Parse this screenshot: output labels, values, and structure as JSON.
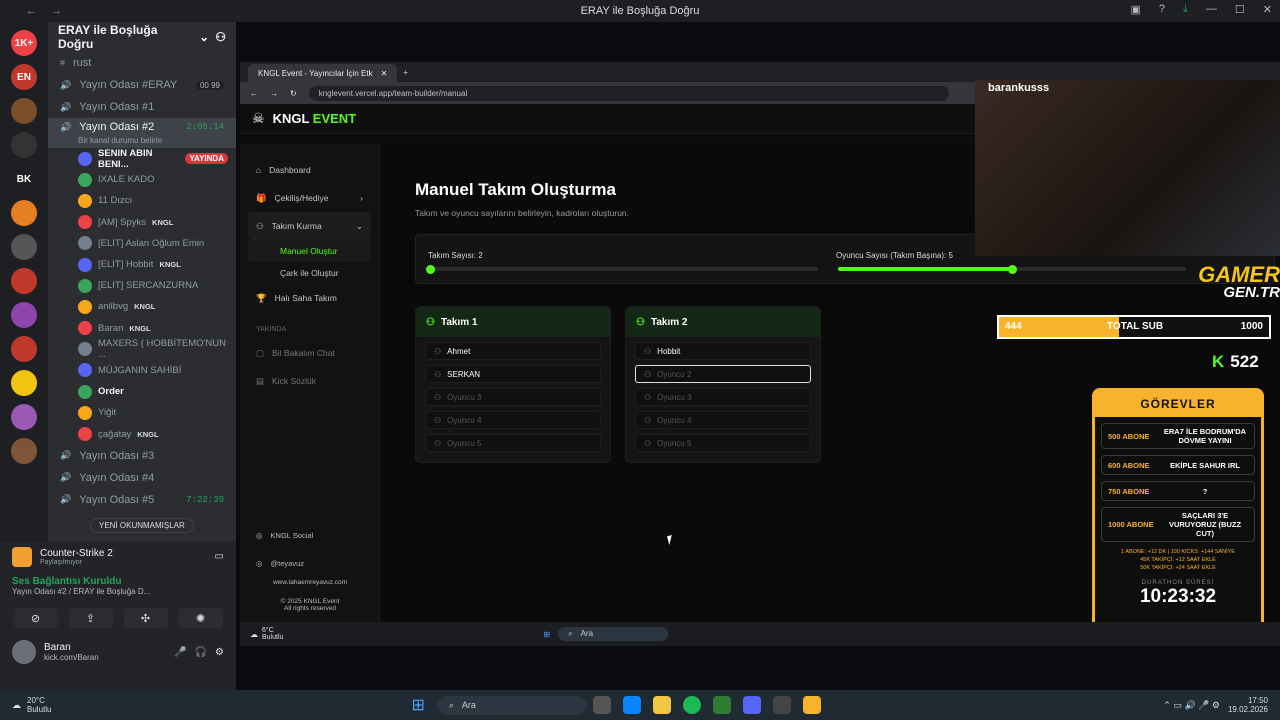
{
  "window": {
    "title": "ERAY ile Boşluğa Doğru"
  },
  "discord": {
    "server_name": "ERAY ile Boşluğa Doğru",
    "servers": [
      {
        "label": "1K+",
        "color": "#ed4245"
      },
      {
        "label": "EN",
        "color": "#c0392b"
      },
      {
        "label": "",
        "color": "#7b4f2c"
      },
      {
        "label": "",
        "color": "#333"
      },
      {
        "label": "BK",
        "color": "#1e1f22"
      },
      {
        "label": "",
        "color": "#e67e22"
      },
      {
        "label": "",
        "color": "#555"
      },
      {
        "label": "",
        "color": "#c0392b"
      },
      {
        "label": "",
        "color": "#8e44ad"
      },
      {
        "label": "",
        "color": "#c0392b"
      },
      {
        "label": "",
        "color": "#f1c40f"
      },
      {
        "label": "",
        "color": "#9b59b6"
      },
      {
        "label": "",
        "color": "#7f5539"
      }
    ],
    "channels": [
      {
        "name": "rust",
        "type": "text"
      },
      {
        "name": "Yayın Odası #ERAY",
        "count": "00 99"
      },
      {
        "name": "Yayın Odası #1"
      },
      {
        "name": "Yayın Odası #2",
        "time": "2:05:14",
        "active": true,
        "sub": "Bir kanal durumu belirle"
      }
    ],
    "users": [
      {
        "name": "SENIN ABIN BENI...",
        "bold": true,
        "live": "YAYINDA"
      },
      {
        "name": "IXALE KADO"
      },
      {
        "name": "11 Dızcı"
      },
      {
        "name": "[AM] Spyks",
        "tag": "KNGL"
      },
      {
        "name": "[ELIT] Aslan Oğlum Emin"
      },
      {
        "name": "[ELIT] Hobbit",
        "tag": "KNGL"
      },
      {
        "name": "[ELIT] SERCANZURNA"
      },
      {
        "name": "anilbvg",
        "tag": "KNGL"
      },
      {
        "name": "Baran",
        "tag": "KNGL"
      },
      {
        "name": "MAXERS ( HOBBİTEMO'NUN ..."
      },
      {
        "name": "MÜJGANIN SAHİBİ"
      },
      {
        "name": "Order",
        "bold": true
      },
      {
        "name": "Yiğit"
      },
      {
        "name": "çağatay",
        "tag": "KNGL"
      }
    ],
    "channels_after": [
      {
        "name": "Yayın Odası #3"
      },
      {
        "name": "Yayın Odası #4"
      },
      {
        "name": "Yayın Odası #5",
        "time": "7:22:39"
      }
    ],
    "new_unread": "YENİ OKUNMAMIŞLAR",
    "live_badge": "YAYINDA",
    "game": {
      "title": "Counter-Strike 2",
      "sub": "Paylaşılmıyor"
    },
    "voice": {
      "title": "Ses Bağlantısı Kuruldu",
      "sub": "Yayın Odası #2 / ERAY ile Boşluğa D..."
    },
    "me": {
      "name": "Baran",
      "status": "kick.com/Baran"
    },
    "weather": {
      "temp": "20°C",
      "desc": "Bulutlu"
    }
  },
  "browser": {
    "tab": "KNGL Event - Yayıncılar İçin Etk",
    "url": "knglevent.vercel.app/team-builder/manual",
    "logo_a": "KNGL",
    "logo_b": "EVENT",
    "nav": {
      "dashboard": "Dashboard",
      "giveaway": "Çekiliş/Hediye",
      "team": "Takım Kurma",
      "manual": "Manuel Oluştur",
      "wheel": "Çark ile Oluştur",
      "pitch": "Halı Saha Takım",
      "soon": "YAKINDA",
      "chat": "Bil Bakalım Chat",
      "dict": "Kick Sözlük"
    },
    "foot": {
      "social": "KNGL Social",
      "insta": "@teyavuz",
      "site": "www.tahaemreyavuz.com",
      "copy1": "© 2025 KNGL Event",
      "copy2": "All rights reserved"
    },
    "page": {
      "title": "Manuel Takım Oluşturma",
      "subtitle": "Takım ve oyuncu sayılarını belirleyin, kadroları oluşturun.",
      "team_count_label": "Takım Sayısı: 2",
      "team_count_fill": 0.0,
      "player_count_label": "Oyuncu Sayısı (Takım Başına): 5",
      "player_count_fill": 0.5,
      "teams": [
        {
          "name": "Takım 1",
          "slots": [
            {
              "v": "Ahmet"
            },
            {
              "v": "SERKAN"
            },
            {
              "p": "Oyuncu 3"
            },
            {
              "p": "Oyuncu 4"
            },
            {
              "p": "Oyuncu 5"
            }
          ]
        },
        {
          "name": "Takım 2",
          "slots": [
            {
              "v": "Hobbit"
            },
            {
              "p": "Oyuncu 2",
              "focus": true
            },
            {
              "p": "Oyuncu 3"
            },
            {
              "p": "Oyuncu 4"
            },
            {
              "p": "Oyuncu 5"
            }
          ]
        }
      ]
    }
  },
  "overlay": {
    "cam_name": "barankusss",
    "brand_a": "GAMER",
    "brand_b": "GEN.TR",
    "sub_current": "444",
    "sub_label": "TOTAL SUB",
    "sub_goal": "1000",
    "sub_fill": 0.444,
    "kick_count": "522",
    "quests_title": "GÖREVLER",
    "quests": [
      {
        "a": "500 ABONE",
        "b": "ERA7 İLE BODRUM'DA DÖVME YAYINI"
      },
      {
        "a": "600 ABONE",
        "b": "EKİPLE SAHUR IRL"
      },
      {
        "a": "750 ABONE",
        "b": "?"
      },
      {
        "a": "1000 ABONE",
        "b": "SAÇLARI 3'E VURUYORUZ (BUZZ CUT)"
      }
    ],
    "note1": "1 ABONE: +12 DK | 100 KICKS: +144 SANİYE",
    "note2": "45K TAKİPÇİ: +12 SAAT EKLE",
    "note3": "50K TAKİPÇİ: +24 SAAT EKLE",
    "timer_label": "DURATHON SÜRESİ",
    "timer": "10:23:32"
  },
  "inner_taskbar": {
    "temp": "6°C",
    "desc": "Bulutlu",
    "search": "Ara"
  },
  "taskbar": {
    "search": "Ara",
    "time": "17:50",
    "date": "19.02.2026"
  }
}
